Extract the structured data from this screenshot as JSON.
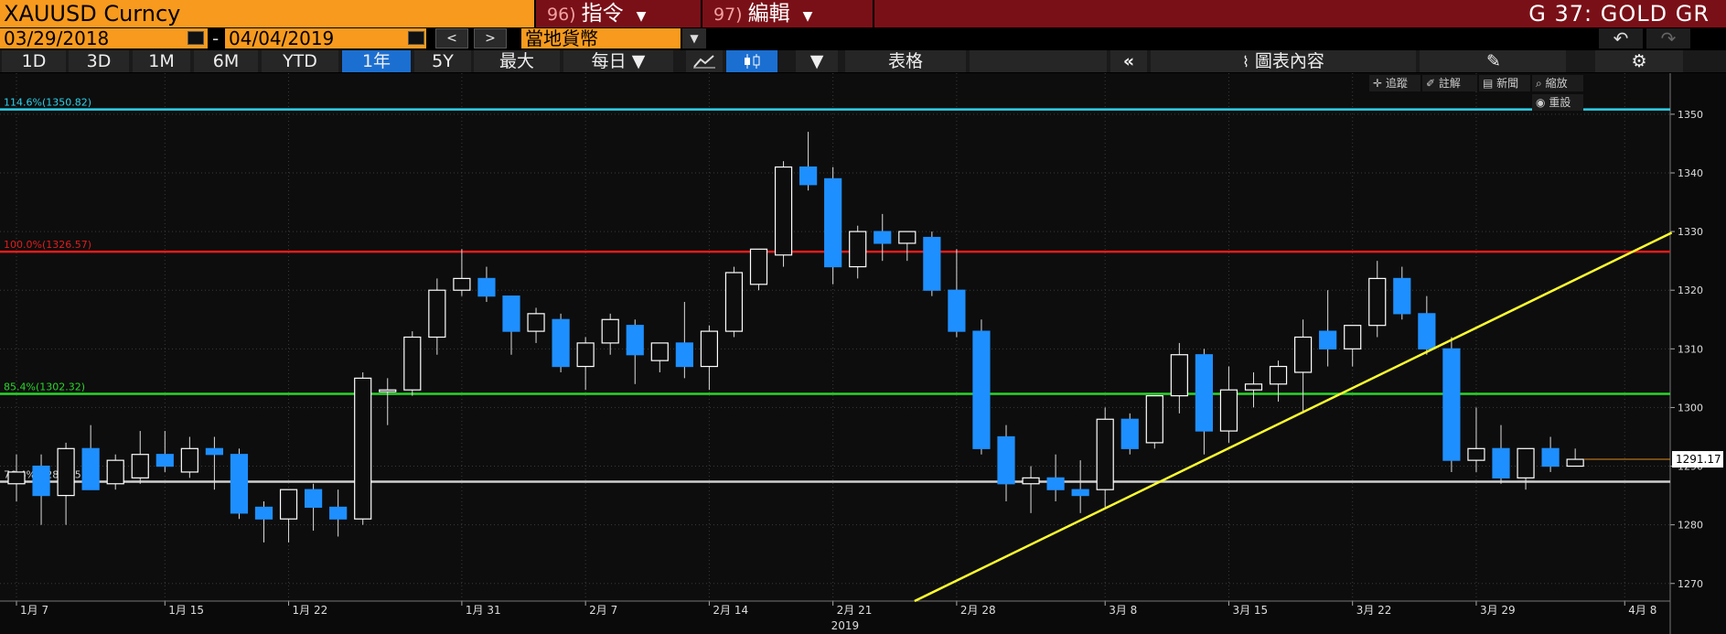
{
  "header": {
    "ticker": "XAUUSD Curncy",
    "menu1_num": "96)",
    "menu1_label": "指令",
    "menu2_num": "97)",
    "menu2_label": "編輯",
    "chart_code": "G 37: GOLD GR"
  },
  "dates": {
    "start": "03/29/2018",
    "sep": "-",
    "end": "04/04/2019",
    "prev": "<",
    "next": ">",
    "currency": "當地貨幣"
  },
  "toolbar": {
    "ranges": [
      "1D",
      "3D",
      "1M",
      "6M",
      "YTD",
      "1年",
      "5Y",
      "最大"
    ],
    "selected_range": "1年",
    "interval": "每日 ▼",
    "table_label": "表格",
    "collapse_label": "«",
    "chart_content_label": "圖表內容"
  },
  "chart_tools": {
    "track": "追蹤",
    "annotate": "註解",
    "news": "新聞",
    "zoom": "縮放",
    "reset": "重設"
  },
  "colors": {
    "up": "#ffffff",
    "down": "#1e8fff",
    "cyan_line": "#2fd0e8",
    "red_line": "#e01c1c",
    "green_line": "#2ad62a",
    "white_line": "#cfcfcf",
    "trend_line": "#ffff30",
    "ticker_bg": "#f79a1e",
    "menu_bg": "#7a1017"
  },
  "chart_data": {
    "type": "candlestick",
    "ylim": [
      1267,
      1357
    ],
    "yticks": [
      1270,
      1280,
      1290,
      1300,
      1310,
      1320,
      1330,
      1340,
      1350
    ],
    "xlabels": [
      "1月 7",
      "1月 15",
      "1月 22",
      "1月 31",
      "2月 7",
      "2月 14",
      "2月 21",
      "2月 28",
      "3月 8",
      "3月 15",
      "3月 22",
      "3月 29",
      "4月 8"
    ],
    "xlabel_index": [
      0,
      6,
      11,
      18,
      23,
      28,
      33,
      38,
      44,
      49,
      54,
      59,
      65
    ],
    "year_label": "2019",
    "last_price": "1291.17",
    "levels": [
      {
        "label": "114.6%(1350.82)",
        "value": 1350.82,
        "color": "#2fd0e8"
      },
      {
        "label": "100.0%(1326.57)",
        "value": 1326.57,
        "color": "#e01c1c"
      },
      {
        "label": "85.4%(1302.32)",
        "value": 1302.32,
        "color": "#2ad62a"
      },
      {
        "label": "76.4%(1287.35)",
        "value": 1287.35,
        "color": "#cfcfcf"
      }
    ],
    "trendline": {
      "from": [
        36.3,
        1267
      ],
      "to": [
        66.9,
        1329.8
      ]
    },
    "candles": [
      {
        "o": 1287,
        "h": 1292,
        "l": 1284,
        "c": 1289
      },
      {
        "o": 1290,
        "h": 1292,
        "l": 1280,
        "c": 1285
      },
      {
        "o": 1285,
        "h": 1294,
        "l": 1280,
        "c": 1293
      },
      {
        "o": 1293,
        "h": 1297,
        "l": 1286,
        "c": 1286
      },
      {
        "o": 1287,
        "h": 1292,
        "l": 1286,
        "c": 1291
      },
      {
        "o": 1288,
        "h": 1296,
        "l": 1287,
        "c": 1292
      },
      {
        "o": 1292,
        "h": 1296,
        "l": 1289,
        "c": 1290
      },
      {
        "o": 1289,
        "h": 1295,
        "l": 1288,
        "c": 1293
      },
      {
        "o": 1293,
        "h": 1295,
        "l": 1286,
        "c": 1292
      },
      {
        "o": 1292,
        "h": 1293,
        "l": 1281,
        "c": 1282
      },
      {
        "o": 1283,
        "h": 1284,
        "l": 1277,
        "c": 1281
      },
      {
        "o": 1281,
        "h": 1286,
        "l": 1277,
        "c": 1286
      },
      {
        "o": 1286,
        "h": 1287,
        "l": 1279,
        "c": 1283
      },
      {
        "o": 1283,
        "h": 1286,
        "l": 1278,
        "c": 1281
      },
      {
        "o": 1281,
        "h": 1306,
        "l": 1280,
        "c": 1305
      },
      {
        "o": 1303,
        "h": 1305,
        "l": 1297,
        "c": 1303
      },
      {
        "o": 1303,
        "h": 1313,
        "l": 1302,
        "c": 1312
      },
      {
        "o": 1312,
        "h": 1322,
        "l": 1309,
        "c": 1320
      },
      {
        "o": 1320,
        "h": 1327,
        "l": 1319,
        "c": 1322
      },
      {
        "o": 1322,
        "h": 1324,
        "l": 1318,
        "c": 1319
      },
      {
        "o": 1319,
        "h": 1319,
        "l": 1309,
        "c": 1313
      },
      {
        "o": 1313,
        "h": 1317,
        "l": 1311,
        "c": 1316
      },
      {
        "o": 1315,
        "h": 1316,
        "l": 1306,
        "c": 1307
      },
      {
        "o": 1307,
        "h": 1312,
        "l": 1303,
        "c": 1311
      },
      {
        "o": 1311,
        "h": 1316,
        "l": 1309,
        "c": 1315
      },
      {
        "o": 1314,
        "h": 1315,
        "l": 1304,
        "c": 1309
      },
      {
        "o": 1308,
        "h": 1310,
        "l": 1306,
        "c": 1311
      },
      {
        "o": 1311,
        "h": 1318,
        "l": 1305,
        "c": 1307
      },
      {
        "o": 1307,
        "h": 1314,
        "l": 1303,
        "c": 1313
      },
      {
        "o": 1313,
        "h": 1324,
        "l": 1312,
        "c": 1323
      },
      {
        "o": 1321,
        "h": 1327,
        "l": 1320,
        "c": 1327
      },
      {
        "o": 1326,
        "h": 1342,
        "l": 1324,
        "c": 1341
      },
      {
        "o": 1341,
        "h": 1347,
        "l": 1337,
        "c": 1338
      },
      {
        "o": 1339,
        "h": 1341,
        "l": 1321,
        "c": 1324
      },
      {
        "o": 1324,
        "h": 1331,
        "l": 1322,
        "c": 1330
      },
      {
        "o": 1330,
        "h": 1333,
        "l": 1325,
        "c": 1328
      },
      {
        "o": 1328,
        "h": 1330,
        "l": 1325,
        "c": 1330
      },
      {
        "o": 1329,
        "h": 1330,
        "l": 1319,
        "c": 1320
      },
      {
        "o": 1320,
        "h": 1327,
        "l": 1312,
        "c": 1313
      },
      {
        "o": 1313,
        "h": 1315,
        "l": 1292,
        "c": 1293
      },
      {
        "o": 1295,
        "h": 1297,
        "l": 1284,
        "c": 1287
      },
      {
        "o": 1287,
        "h": 1290,
        "l": 1282,
        "c": 1288
      },
      {
        "o": 1288,
        "h": 1292,
        "l": 1284,
        "c": 1286
      },
      {
        "o": 1286,
        "h": 1291,
        "l": 1282,
        "c": 1285
      },
      {
        "o": 1286,
        "h": 1300,
        "l": 1283,
        "c": 1298
      },
      {
        "o": 1298,
        "h": 1299,
        "l": 1292,
        "c": 1293
      },
      {
        "o": 1294,
        "h": 1302,
        "l": 1293,
        "c": 1302
      },
      {
        "o": 1302,
        "h": 1311,
        "l": 1299,
        "c": 1309
      },
      {
        "o": 1309,
        "h": 1310,
        "l": 1292,
        "c": 1296
      },
      {
        "o": 1296,
        "h": 1307,
        "l": 1294,
        "c": 1303
      },
      {
        "o": 1303,
        "h": 1306,
        "l": 1300,
        "c": 1304
      },
      {
        "o": 1304,
        "h": 1308,
        "l": 1301,
        "c": 1307
      },
      {
        "o": 1306,
        "h": 1315,
        "l": 1299,
        "c": 1312
      },
      {
        "o": 1313,
        "h": 1320,
        "l": 1307,
        "c": 1310
      },
      {
        "o": 1310,
        "h": 1314,
        "l": 1307,
        "c": 1314
      },
      {
        "o": 1314,
        "h": 1325,
        "l": 1312,
        "c": 1322
      },
      {
        "o": 1322,
        "h": 1324,
        "l": 1315,
        "c": 1316
      },
      {
        "o": 1316,
        "h": 1319,
        "l": 1309,
        "c": 1310
      },
      {
        "o": 1310,
        "h": 1312,
        "l": 1289,
        "c": 1291
      },
      {
        "o": 1291,
        "h": 1300,
        "l": 1289,
        "c": 1293
      },
      {
        "o": 1293,
        "h": 1297,
        "l": 1287,
        "c": 1288
      },
      {
        "o": 1288,
        "h": 1293,
        "l": 1286,
        "c": 1293
      },
      {
        "o": 1293,
        "h": 1295,
        "l": 1289,
        "c": 1290
      },
      {
        "o": 1290,
        "h": 1293,
        "l": 1290,
        "c": 1291.17
      }
    ]
  }
}
